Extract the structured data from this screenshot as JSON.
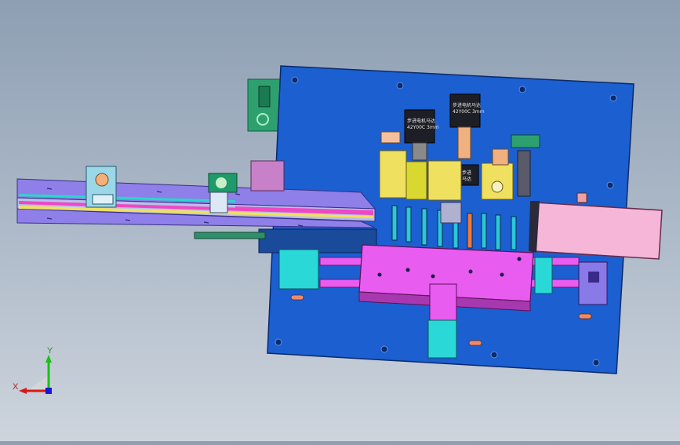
{
  "viewport": {
    "triad": {
      "x_label": "X",
      "y_label": "Y"
    },
    "motor_labels": {
      "motor_1_line1": "步进电机马达",
      "motor_1_line2": "42Y00C 3mm",
      "motor_2_line1": "步进电机马达",
      "motor_2_line2": "42Y00C 3mm",
      "motor_3_line1": "步进",
      "motor_3_line2": "马达"
    },
    "colors": {
      "base_plate": "#1b5fd0",
      "slide_rail": "#8f7fe8",
      "table_block": "#e85cf0",
      "sensor_green": "#1f9a6a",
      "cover_pink": "#f5b6d8",
      "cylinder_yellow": "#f0e060"
    }
  }
}
